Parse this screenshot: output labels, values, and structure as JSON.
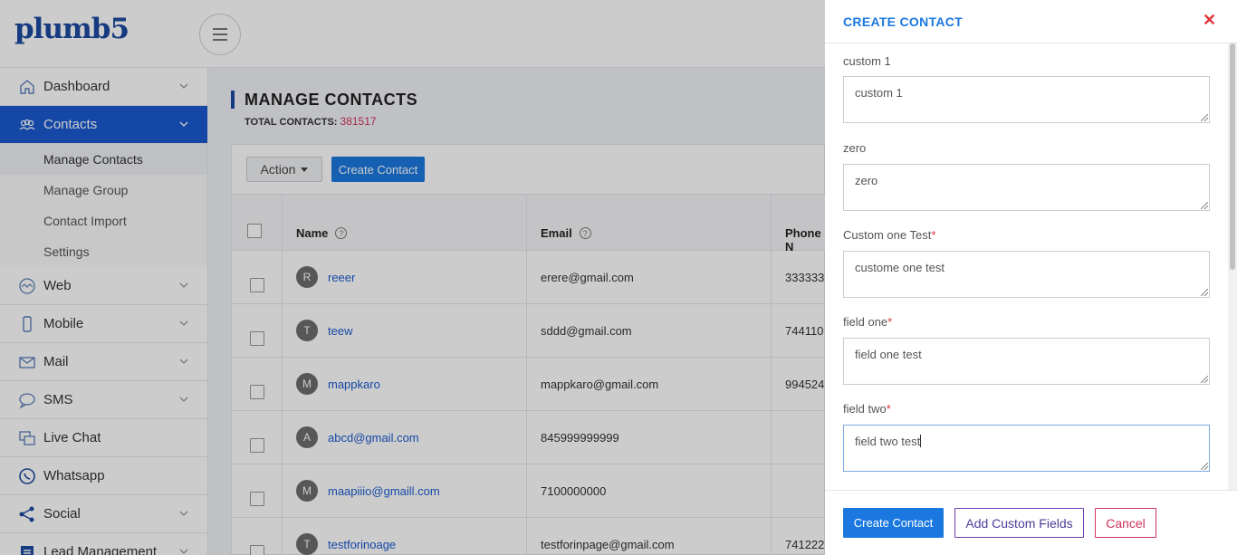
{
  "brand": {
    "logo_text": "plumb5"
  },
  "sidebar": {
    "items": [
      {
        "label": "Dashboard",
        "icon": "home-icon"
      },
      {
        "label": "Contacts",
        "icon": "contacts-icon"
      },
      {
        "label": "Web",
        "icon": "web-icon"
      },
      {
        "label": "Mobile",
        "icon": "mobile-icon"
      },
      {
        "label": "Mail",
        "icon": "mail-icon"
      },
      {
        "label": "SMS",
        "icon": "sms-icon"
      },
      {
        "label": "Live Chat",
        "icon": "chat-icon"
      },
      {
        "label": "Whatsapp",
        "icon": "whatsapp-icon"
      },
      {
        "label": "Social",
        "icon": "share-icon"
      },
      {
        "label": "Lead Management",
        "icon": "lead-icon"
      }
    ],
    "subitems": [
      "Manage Contacts",
      "Manage Group",
      "Contact Import",
      "Settings"
    ]
  },
  "main": {
    "title": "MANAGE CONTACTS",
    "total_label": "TOTAL CONTACTS:",
    "total_value": "381517",
    "action_label": "Action",
    "create_label": "Create Contact",
    "columns": {
      "name": "Name",
      "email": "Email",
      "phone": "Phone N"
    },
    "rows": [
      {
        "initial": "R",
        "name": "reeer",
        "email": "erere@gmail.com",
        "phone": "333333"
      },
      {
        "initial": "T",
        "name": "teew",
        "email": "sddd@gmail.com",
        "phone": "744110"
      },
      {
        "initial": "M",
        "name": "mappkaro",
        "email": "mappkaro@gmail.com",
        "phone": "994524"
      },
      {
        "initial": "A",
        "name": "abcd@gmail.com",
        "email": "845999999999",
        "phone": ""
      },
      {
        "initial": "M",
        "name": "maapiiio@gmaill.com",
        "email": "7100000000",
        "phone": ""
      },
      {
        "initial": "T",
        "name": "testforinoage",
        "email": "testforinpage@gmail.com",
        "phone": "741222"
      }
    ]
  },
  "panel": {
    "title": "CREATE CONTACT",
    "close_symbol": "✕",
    "fields": [
      {
        "label": "custom 1",
        "required": "",
        "value": "custom 1"
      },
      {
        "label": "zero",
        "required": "",
        "value": "zero"
      },
      {
        "label": "Custom one Test",
        "required": "*",
        "value": "custome one test"
      },
      {
        "label": "field one",
        "required": "*",
        "value": "field one test"
      },
      {
        "label": "field two",
        "required": "*",
        "value": "field two test"
      }
    ],
    "buttons": {
      "create": "Create Contact",
      "add_fields": "Add Custom Fields",
      "cancel": "Cancel"
    }
  },
  "colors": {
    "brand": "#1d4aa0",
    "accent": "#1b78e0",
    "danger": "#e0343a",
    "total": "#d0335a"
  }
}
